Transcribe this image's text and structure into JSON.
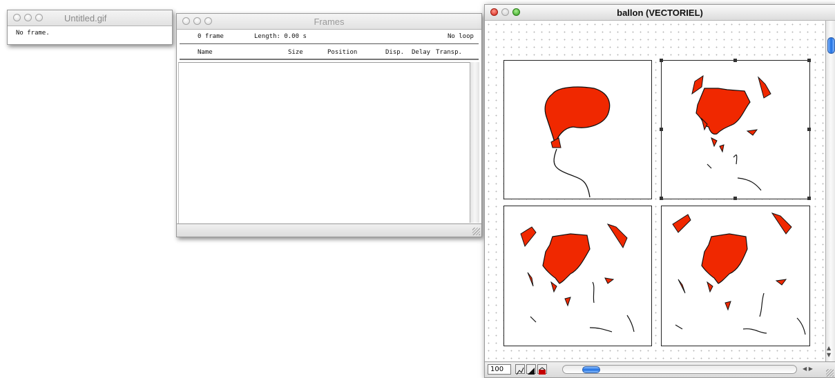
{
  "windows": {
    "untitled": {
      "title": "Untitled.gif",
      "status": "No frame."
    },
    "frames": {
      "title": "Frames",
      "info": {
        "frame_count": "0 frame",
        "length": "Length: 0.00 s",
        "loop": "No loop"
      },
      "columns": [
        "Name",
        "Size",
        "Position",
        "Disp.",
        "Delay",
        "Transp."
      ]
    },
    "ballon": {
      "title": "ballon (VECTORIEL)",
      "zoom": "100",
      "balloon_color": "#f02800",
      "grid_color": "#b7b7b7",
      "vscroll_position": 0.05,
      "hscroll_position": 0.1
    }
  },
  "icons": [
    "close-light",
    "minimize-light",
    "zoom-light",
    "resize-grip",
    "pen-tool-icon",
    "shape-tool-icon",
    "fill-tool-icon"
  ]
}
